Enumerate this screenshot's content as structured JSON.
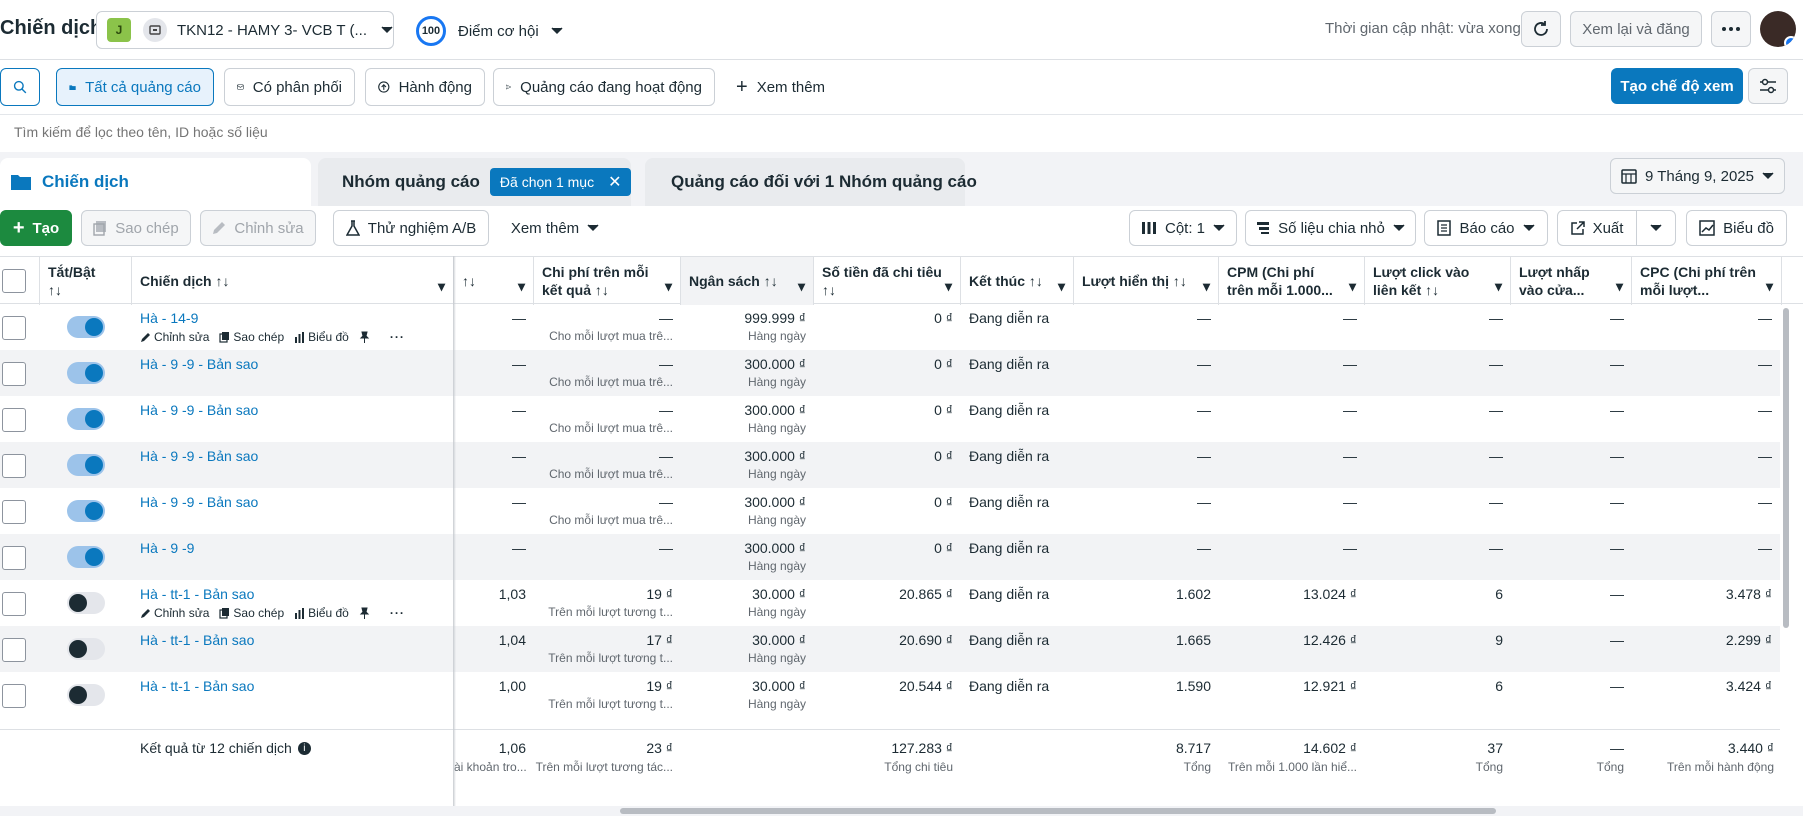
{
  "header": {
    "title": "Chiến dịch",
    "account_initial": "J",
    "account_name": "TKN12 - HAMY 3- VCB T (...",
    "opportunity_score": "100",
    "opportunity_label": "Điểm cơ hội",
    "updated": "Thời gian cập nhật: vừa xong",
    "review_publish": "Xem lại và đăng"
  },
  "filters": {
    "all_ads": "Tất cả quảng cáo",
    "delivering": "Có phân phối",
    "actions": "Hành động",
    "active_ads": "Quảng cáo đang hoạt động",
    "see_more": "Xem thêm",
    "create_view": "Tạo chế độ xem"
  },
  "search": {
    "placeholder": "Tìm kiếm để lọc theo tên, ID hoặc số liệu"
  },
  "tabs": {
    "campaign": "Chiến dịch",
    "adset": "Nhóm quảng cáo",
    "adset_badge": "Đã chọn 1 mục",
    "ads": "Quảng cáo đối với 1 Nhóm quảng cáo"
  },
  "date_range": "9 Tháng 9, 2025",
  "toolbar": {
    "create": "Tạo",
    "duplicate": "Sao chép",
    "edit": "Chỉnh sửa",
    "ab_test": "Thử nghiệm A/B",
    "more": "Xem thêm",
    "columns": "Cột: 1",
    "breakdown": "Số liệu chia nhỏ",
    "reports": "Báo cáo",
    "export": "Xuất",
    "chart": "Biểu đồ"
  },
  "row_actions": {
    "edit": "Chỉnh sửa",
    "duplicate": "Sao chép",
    "chart": "Biểu đồ"
  },
  "columns": {
    "toggle": "Tắt/Bật",
    "toggle_sort": "↑↓",
    "campaign": "Chiến dịch ↑↓",
    "result_rate": "↑↓",
    "cost_per_result": "Chi phí trên mỗi kết quả ↑↓",
    "budget": "Ngân sách ↑↓",
    "amount_spent": "Số tiền đã chi tiêu ↑↓",
    "ends": "Kết thúc ↑↓",
    "impressions": "Lượt hiển thị ↑↓",
    "cpm": "CPM (Chi phí trên mỗi 1.000...",
    "link_clicks": "Lượt click vào liên kết ↑↓",
    "shop_clicks": "Lượt nhấp vào cửa...",
    "cpc": "CPC (Chi phí trên mỗi lượt..."
  },
  "rows": [
    {
      "name": "Hà - 14-9",
      "on": true,
      "actions": true,
      "rate": "—",
      "cpr": "—",
      "cpr_sub": "Cho mỗi lượt mua trê...",
      "budget": "999.999 ₫",
      "budget_sub": "Hàng ngày",
      "spent": "0 ₫",
      "ends": "Đang diễn ra",
      "impr": "—",
      "cpm": "—",
      "clicks": "—",
      "shop": "—",
      "cpc": "—"
    },
    {
      "name": "Hà - 9 -9 - Bản sao",
      "on": true,
      "actions": false,
      "rate": "—",
      "cpr": "—",
      "cpr_sub": "Cho mỗi lượt mua trê...",
      "budget": "300.000 ₫",
      "budget_sub": "Hàng ngày",
      "spent": "0 ₫",
      "ends": "Đang diễn ra",
      "impr": "—",
      "cpm": "—",
      "clicks": "—",
      "shop": "—",
      "cpc": "—"
    },
    {
      "name": "Hà - 9 -9 - Bản sao",
      "on": true,
      "actions": false,
      "rate": "—",
      "cpr": "—",
      "cpr_sub": "Cho mỗi lượt mua trê...",
      "budget": "300.000 ₫",
      "budget_sub": "Hàng ngày",
      "spent": "0 ₫",
      "ends": "Đang diễn ra",
      "impr": "—",
      "cpm": "—",
      "clicks": "—",
      "shop": "—",
      "cpc": "—"
    },
    {
      "name": "Hà - 9 -9 - Bản sao",
      "on": true,
      "actions": false,
      "rate": "—",
      "cpr": "—",
      "cpr_sub": "Cho mỗi lượt mua trê...",
      "budget": "300.000 ₫",
      "budget_sub": "Hàng ngày",
      "spent": "0 ₫",
      "ends": "Đang diễn ra",
      "impr": "—",
      "cpm": "—",
      "clicks": "—",
      "shop": "—",
      "cpc": "—"
    },
    {
      "name": "Hà - 9 -9 - Bản sao",
      "on": true,
      "actions": false,
      "rate": "—",
      "cpr": "—",
      "cpr_sub": "Cho mỗi lượt mua trê...",
      "budget": "300.000 ₫",
      "budget_sub": "Hàng ngày",
      "spent": "0 ₫",
      "ends": "Đang diễn ra",
      "impr": "—",
      "cpm": "—",
      "clicks": "—",
      "shop": "—",
      "cpc": "—"
    },
    {
      "name": "Hà - 9 -9",
      "on": true,
      "actions": false,
      "rate": "—",
      "cpr": "—",
      "cpr_sub": "",
      "budget": "300.000 ₫",
      "budget_sub": "Hàng ngày",
      "spent": "0 ₫",
      "ends": "Đang diễn ra",
      "impr": "—",
      "cpm": "—",
      "clicks": "—",
      "shop": "—",
      "cpc": "—"
    },
    {
      "name": "Hà - tt-1 - Bản sao",
      "on": false,
      "actions": true,
      "rate": "1,03",
      "cpr": "19 ₫",
      "cpr_sub": "Trên mỗi lượt tương t...",
      "budget": "30.000 ₫",
      "budget_sub": "Hàng ngày",
      "spent": "20.865 ₫",
      "ends": "Đang diễn ra",
      "impr": "1.602",
      "cpm": "13.024 ₫",
      "clicks": "6",
      "shop": "—",
      "cpc": "3.478 ₫"
    },
    {
      "name": "Hà - tt-1 - Bản sao",
      "on": false,
      "actions": false,
      "rate": "1,04",
      "cpr": "17 ₫",
      "cpr_sub": "Trên mỗi lượt tương t...",
      "budget": "30.000 ₫",
      "budget_sub": "Hàng ngày",
      "spent": "20.690 ₫",
      "ends": "Đang diễn ra",
      "impr": "1.665",
      "cpm": "12.426 ₫",
      "clicks": "9",
      "shop": "—",
      "cpc": "2.299 ₫"
    },
    {
      "name": "Hà - tt-1 - Bản sao",
      "on": false,
      "actions": false,
      "rate": "1,00",
      "cpr": "19 ₫",
      "cpr_sub": "Trên mỗi lượt tương t...",
      "budget": "30.000 ₫",
      "budget_sub": "Hàng ngày",
      "spent": "20.544 ₫",
      "ends": "Đang diễn ra",
      "impr": "1.590",
      "cpm": "12.921 ₫",
      "clicks": "6",
      "shop": "—",
      "cpc": "3.424 ₫"
    }
  ],
  "footer": {
    "label": "Kết quả từ 12 chiến dịch",
    "rate": "1,06",
    "rate_sub": "ài khoản tro...",
    "cpr": "23 ₫",
    "cpr_sub": "Trên mỗi lượt tương tác...",
    "spent": "127.283 ₫",
    "spent_sub": "Tổng chi tiêu",
    "impr": "8.717",
    "impr_sub": "Tổng",
    "cpm": "14.602 ₫",
    "cpm_sub": "Trên mỗi 1.000 lần hiể...",
    "clicks": "37",
    "clicks_sub": "Tổng",
    "shop": "—",
    "shop_sub": "Tổng",
    "cpc": "3.440 ₫",
    "cpc_sub": "Trên mỗi hành động"
  },
  "colors": {
    "primary": "#0a78be",
    "create": "#1c8a3f",
    "toggle_on": "#0a78be"
  }
}
